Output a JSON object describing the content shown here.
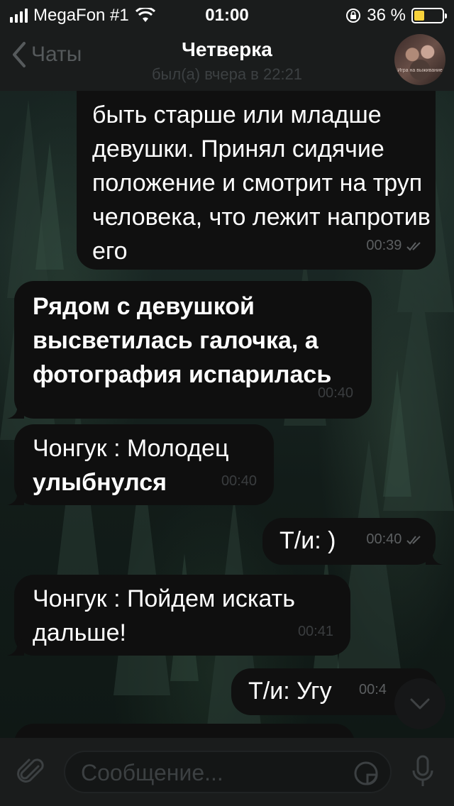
{
  "status_bar": {
    "carrier": "MegaFon #1",
    "time": "01:00",
    "battery_percent": "36 %",
    "battery_level": 0.36,
    "icons": [
      "signal-icon",
      "wifi-icon",
      "rotation-lock-icon",
      "battery-icon"
    ]
  },
  "header": {
    "back_label": "Чаты",
    "title": "Четверка",
    "subtitle": "был(а) вчера в 22:21",
    "avatar_caption": "Игра на выживание"
  },
  "messages": [
    {
      "direction": "out",
      "text": "быть старше или младше девушки. Принял сидячие положение и смотрит на труп человека, что лежит напротив его",
      "time": "00:39",
      "read": true
    },
    {
      "direction": "in",
      "text": "Рядом с девушкой высветилась галочка, а фотография испарилась",
      "time": "00:40"
    },
    {
      "direction": "in",
      "text_plain": "Чонгук : Молодец",
      "text_bold": "улыбнулся",
      "time": "00:40"
    },
    {
      "direction": "out",
      "text": "Т/и: )",
      "time": "00:40",
      "read": true
    },
    {
      "direction": "in",
      "text": "Чонгук : Пойдем искать дальше!",
      "time": "00:41"
    },
    {
      "direction": "out",
      "text": "Т/и: Угу",
      "time": "00:4",
      "read": true
    }
  ],
  "input": {
    "placeholder": "Сообщение..."
  },
  "colors": {
    "bar_background": "#1a1c1c",
    "bubble": "#0f0f0f",
    "battery_fill": "#f7d23b"
  }
}
